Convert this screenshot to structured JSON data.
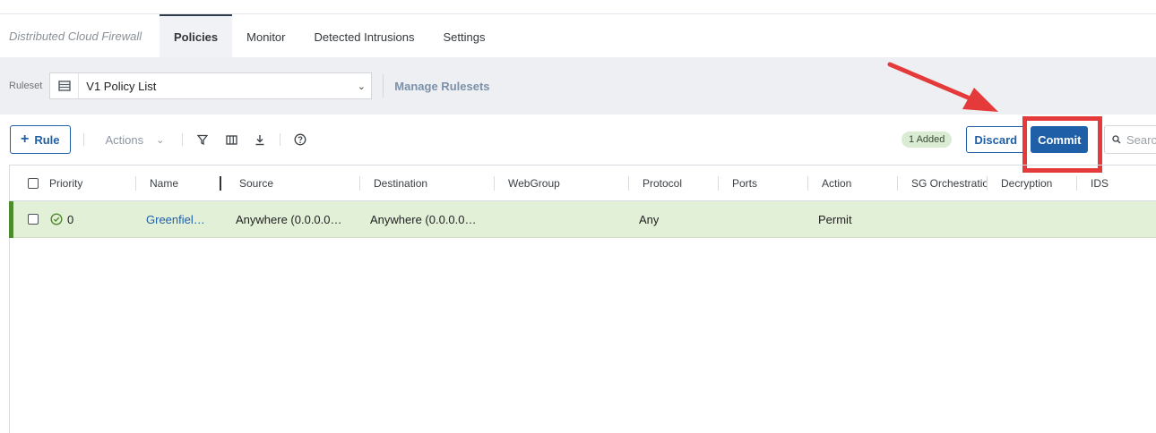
{
  "app_title": "Distributed Cloud Firewall",
  "tabs": [
    {
      "label": "Policies",
      "active": true
    },
    {
      "label": "Monitor",
      "active": false
    },
    {
      "label": "Detected Intrusions",
      "active": false
    },
    {
      "label": "Settings",
      "active": false
    }
  ],
  "ruleset": {
    "label": "Ruleset",
    "value": "V1 Policy List",
    "manage_link": "Manage Rulesets"
  },
  "toolbar": {
    "add_rule_label": "Rule",
    "actions_label": "Actions",
    "added_badge": "1 Added",
    "discard_label": "Discard",
    "commit_label": "Commit",
    "search_placeholder": "Search"
  },
  "table": {
    "columns": [
      "Priority",
      "Name",
      "Source",
      "Destination",
      "WebGroup",
      "Protocol",
      "Ports",
      "Action",
      "SG Orchestration",
      "Decryption",
      "IDS"
    ],
    "rows": [
      {
        "priority": "0",
        "name": "Greenfiel…",
        "source": "Anywhere (0.0.0.0…",
        "destination": "Anywhere (0.0.0.0…",
        "webgroup": "",
        "protocol": "Any",
        "ports": "",
        "action": "Permit",
        "sg_orchestration": "",
        "decryption": "",
        "ids": ""
      }
    ]
  },
  "colors": {
    "primary": "#1f5fa8",
    "row_added": "#e3f0d8",
    "row_accent": "#4e8a2e",
    "highlight": "#e53a3a"
  }
}
